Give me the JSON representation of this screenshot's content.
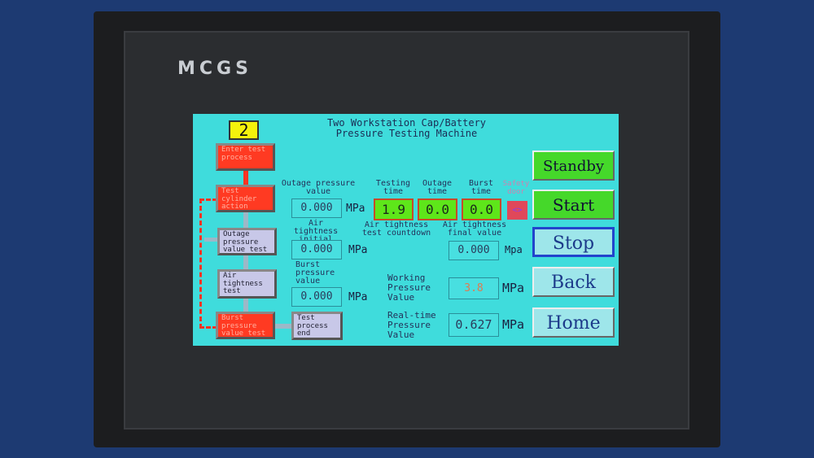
{
  "device": {
    "brand": "MCGS"
  },
  "header": {
    "title_line1": "Two Workstation Cap/Battery",
    "title_line2": "Pressure Testing Machine",
    "workstation": "2"
  },
  "flow": [
    {
      "label": "Enter test process",
      "state": "active"
    },
    {
      "label": "Test cylinder action",
      "state": "active"
    },
    {
      "label": "Outage pressure value test",
      "state": "inactive"
    },
    {
      "label": "Air tightness test",
      "state": "inactive"
    },
    {
      "label": "Burst pressure value test",
      "state": "active"
    },
    {
      "label": "Test process end",
      "state": "inactive"
    }
  ],
  "fields": {
    "outage_pressure": {
      "label": "Outage pressure value",
      "value": "0.000",
      "unit": "MPa"
    },
    "air_initial": {
      "label": "Air tightness initial value",
      "value": "0.000",
      "unit": "MPa"
    },
    "burst_pressure": {
      "label": "Burst pressure value",
      "value": "0.000",
      "unit": "MPa"
    },
    "testing_time": {
      "label": "Testing time",
      "value": "1.9"
    },
    "outage_time": {
      "label": "Outage time",
      "value": "0.0"
    },
    "burst_time": {
      "label": "Burst time",
      "value": "0.0"
    },
    "safety_door": {
      "label": "Safety door",
      "value": "<>"
    },
    "countdown_label": "Air tightness test countdown",
    "air_final": {
      "label": "Air tightness final value",
      "value": "0.000",
      "unit": "Mpa"
    },
    "working_pressure": {
      "label": "Working Pressure Value",
      "value": "3.8",
      "unit": "MPa"
    },
    "realtime_pressure": {
      "label": "Real-time Pressure Value",
      "value": "0.627",
      "unit": "MPa"
    }
  },
  "buttons": {
    "standby": "Standby",
    "start": "Start",
    "stop": "Stop",
    "back": "Back",
    "home": "Home"
  },
  "colors": {
    "screen": "#3fdcdc",
    "active_step": "#ff3a22",
    "timer_bg": "#5ee61a",
    "indicator": "#f4f20c"
  }
}
